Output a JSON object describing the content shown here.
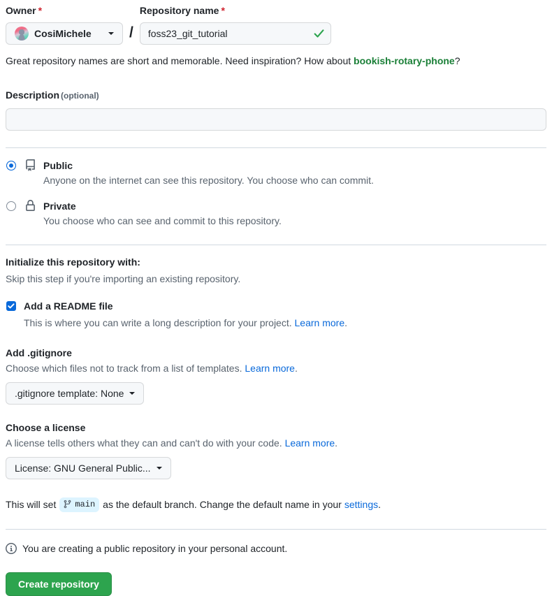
{
  "owner": {
    "label": "Owner",
    "required_mark": "*",
    "name": "CosiMichele",
    "avatar_icon": "user-avatar-image"
  },
  "repo_name": {
    "label": "Repository name",
    "required_mark": "*",
    "value": "foss23_git_tutorial",
    "placeholder": "",
    "valid_icon": "check-icon",
    "separator": "/"
  },
  "hint": {
    "prefix": "Great repository names are short and memorable. Need inspiration? How about ",
    "suggestion": "bookish-rotary-phone",
    "suffix": "?"
  },
  "description": {
    "label": "Description",
    "optional": "(optional)",
    "value": "",
    "placeholder": ""
  },
  "visibility": {
    "options": [
      {
        "id": "public",
        "title": "Public",
        "description": "Anyone on the internet can see this repository. You choose who can commit.",
        "icon": "repo-book-icon",
        "selected": true
      },
      {
        "id": "private",
        "title": "Private",
        "description": "You choose who can see and commit to this repository.",
        "icon": "lock-icon",
        "selected": false
      }
    ]
  },
  "initialize": {
    "heading": "Initialize this repository with:",
    "subtext": "Skip this step if you're importing an existing repository.",
    "readme": {
      "label": "Add a README file",
      "checked": true,
      "description": "This is where you can write a long description for your project. ",
      "link": "Learn more",
      "link_suffix": "."
    }
  },
  "gitignore": {
    "heading": "Add .gitignore",
    "description": "Choose which files not to track from a list of templates. ",
    "link": "Learn more",
    "link_suffix": ".",
    "select_label": ".gitignore template: None",
    "caret_icon": "chevron-down-icon"
  },
  "license": {
    "heading": "Choose a license",
    "description": "A license tells others what they can and can't do with your code. ",
    "link": "Learn more",
    "link_suffix": ".",
    "select_label": "License: GNU General Public...",
    "caret_icon": "chevron-down-icon"
  },
  "default_branch": {
    "prefix": "This will set",
    "branch_icon": "git-branch-icon",
    "branch_name": "main",
    "middle": "as the default branch. Change the default name in your",
    "link": "settings",
    "suffix": "."
  },
  "notice": {
    "icon": "info-icon",
    "text": "You are creating a public repository in your personal account."
  },
  "submit": {
    "label": "Create repository"
  },
  "colors": {
    "accent_blue": "#0969da",
    "success_green": "#1a7f37",
    "button_green": "#2da44e",
    "required_red": "#cf222e",
    "muted_text": "#59636e",
    "badge_blue_bg": "#ddf4ff",
    "field_bg": "#f6f8fa",
    "border": "#d1d9e0"
  }
}
